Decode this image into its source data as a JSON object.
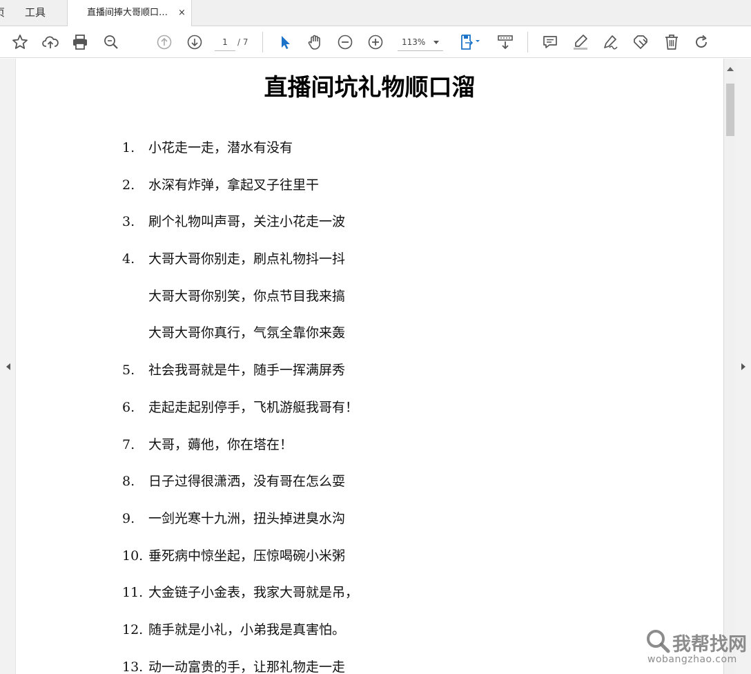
{
  "tabs": {
    "home_label": "页",
    "tools_label": "工具",
    "document_label": "直播间捧大哥顺口…",
    "close_glyph": "×"
  },
  "toolbar": {
    "page_current": "1",
    "page_total": "/ 7",
    "zoom": "113%",
    "icons": [
      "star-icon",
      "cloud-upload-icon",
      "print-icon",
      "zoom-search-icon",
      "arrow-up-icon",
      "arrow-down-icon",
      "select-cursor-icon",
      "hand-tool-icon",
      "zoom-out-icon",
      "zoom-in-icon",
      "page-fit-icon",
      "scroll-mode-icon",
      "comment-icon",
      "highlight-icon",
      "sign-icon",
      "stamp-icon",
      "delete-icon",
      "rotate-icon"
    ],
    "accent_color": "#1a73c8"
  },
  "document": {
    "title": "直播间坑礼物顺口溜",
    "lines": [
      {
        "num": "1.",
        "text": "小花走一走，潜水有没有"
      },
      {
        "num": "2.",
        "text": "水深有炸弹，拿起叉子往里干"
      },
      {
        "num": "3.",
        "text": "刷个礼物叫声哥，关注小花走一波"
      },
      {
        "num": "4.",
        "text": "大哥大哥你别走，刷点礼物抖一抖"
      },
      {
        "num": "",
        "text": "大哥大哥你别笑，你点节目我来搞"
      },
      {
        "num": "",
        "text": "大哥大哥你真行，气氛全靠你来轰"
      },
      {
        "num": "5.",
        "text": "社会我哥就是牛，随手一挥满屏秀"
      },
      {
        "num": "6.",
        "text": "走起走起别停手，飞机游艇我哥有！"
      },
      {
        "num": "7.",
        "text": "大哥，薅他，你在塔在！"
      },
      {
        "num": "8.",
        "text": "日子过得很潇洒，没有哥在怎么耍"
      },
      {
        "num": "9.",
        "text": "一剑光寒十九洲，扭头掉进臭水沟"
      },
      {
        "num": "10.",
        "text": "垂死病中惊坐起，压惊喝碗小米粥"
      },
      {
        "num": "11.",
        "text": "大金链子小金表，我家大哥就是吊，"
      },
      {
        "num": "12.",
        "text": "随手就是小礼，小弟我是真害怕。"
      },
      {
        "num": "13.",
        "text": "动一动富贵的手，让那礼物走一走"
      }
    ]
  },
  "watermark": {
    "text": "我帮找网",
    "url": "wobangzhao.com"
  }
}
